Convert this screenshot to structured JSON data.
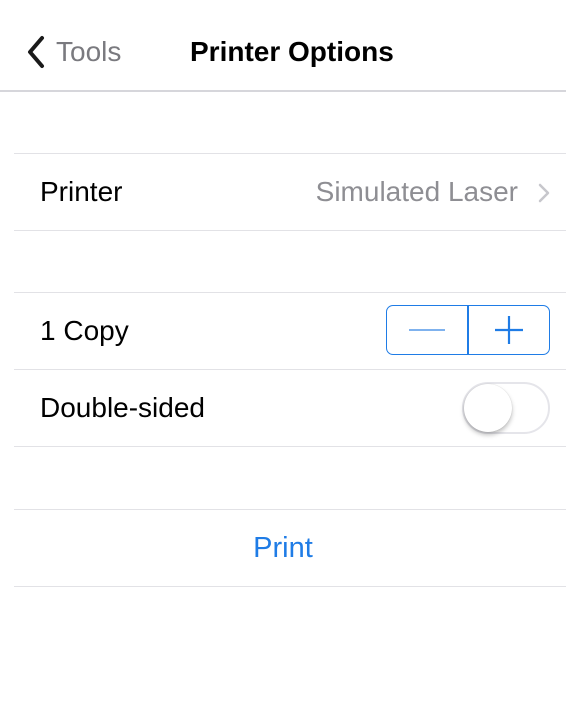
{
  "navbar": {
    "back_label": "Tools",
    "title": "Printer Options",
    "back_icon": "chevron-left-icon"
  },
  "printer_row": {
    "label": "Printer",
    "value": "Simulated Laser",
    "chevron_icon": "chevron-right-icon"
  },
  "copies_row": {
    "label": "1 Copy",
    "decrement_icon": "minus-icon",
    "increment_icon": "plus-icon"
  },
  "double_sided_row": {
    "label": "Double-sided",
    "enabled": false
  },
  "actions": {
    "print_label": "Print"
  },
  "colors": {
    "accent": "#1f7ce6",
    "secondary_text": "#8e8e93",
    "separator": "#e2e2e6"
  }
}
